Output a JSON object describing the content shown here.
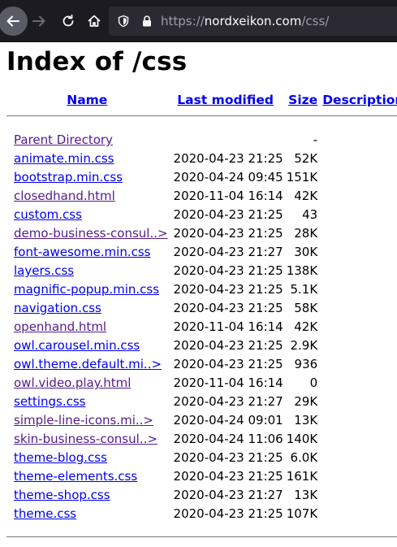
{
  "browser": {
    "url_host": "nordxeikon.com",
    "url_scheme": "https://",
    "url_path": "/css/"
  },
  "page": {
    "title": "Index of /css"
  },
  "table": {
    "headers": {
      "name": "Name",
      "last_modified": "Last modified",
      "size": "Size",
      "description": "Description"
    },
    "parent": {
      "name": "Parent Directory",
      "date": "",
      "size": "-"
    },
    "rows": [
      {
        "name": "animate.min.css",
        "date": "2020-04-23 21:25",
        "size": "52K",
        "visited": false
      },
      {
        "name": "bootstrap.min.css",
        "date": "2020-04-24 09:45",
        "size": "151K",
        "visited": false
      },
      {
        "name": "closedhand.html",
        "date": "2020-11-04 16:14",
        "size": "42K",
        "visited": true
      },
      {
        "name": "custom.css",
        "date": "2020-04-23 21:25",
        "size": "43",
        "visited": false
      },
      {
        "name": "demo-business-consul..>",
        "date": "2020-04-23 21:25",
        "size": "28K",
        "visited": true
      },
      {
        "name": "font-awesome.min.css",
        "date": "2020-04-23 21:27",
        "size": "30K",
        "visited": false
      },
      {
        "name": "layers.css",
        "date": "2020-04-23 21:25",
        "size": "138K",
        "visited": false
      },
      {
        "name": "magnific-popup.min.css",
        "date": "2020-04-23 21:25",
        "size": "5.1K",
        "visited": false
      },
      {
        "name": "navigation.css",
        "date": "2020-04-23 21:25",
        "size": "58K",
        "visited": false
      },
      {
        "name": "openhand.html",
        "date": "2020-11-04 16:14",
        "size": "42K",
        "visited": true
      },
      {
        "name": "owl.carousel.min.css",
        "date": "2020-04-23 21:25",
        "size": "2.9K",
        "visited": false
      },
      {
        "name": "owl.theme.default.mi..>",
        "date": "2020-04-23 21:25",
        "size": "936",
        "visited": false
      },
      {
        "name": "owl.video.play.html",
        "date": "2020-11-04 16:14",
        "size": "0",
        "visited": true
      },
      {
        "name": "settings.css",
        "date": "2020-04-23 21:27",
        "size": "29K",
        "visited": false
      },
      {
        "name": "simple-line-icons.mi..>",
        "date": "2020-04-24 09:01",
        "size": "13K",
        "visited": true
      },
      {
        "name": "skin-business-consul..>",
        "date": "2020-04-24 11:06",
        "size": "140K",
        "visited": true
      },
      {
        "name": "theme-blog.css",
        "date": "2020-04-23 21:25",
        "size": "6.0K",
        "visited": false
      },
      {
        "name": "theme-elements.css",
        "date": "2020-04-23 21:25",
        "size": "161K",
        "visited": false
      },
      {
        "name": "theme-shop.css",
        "date": "2020-04-23 21:27",
        "size": "13K",
        "visited": false
      },
      {
        "name": "theme.css",
        "date": "2020-04-23 21:25",
        "size": "107K",
        "visited": false
      }
    ]
  },
  "colors": {
    "link": "#0000ee",
    "visited": "#551a8b",
    "toolbar_bg": "#1c1b22",
    "urlbar_bg": "#2b2a33"
  },
  "icons": [
    "back-icon",
    "forward-icon",
    "reload-icon",
    "home-icon",
    "shield-icon",
    "lock-icon"
  ]
}
